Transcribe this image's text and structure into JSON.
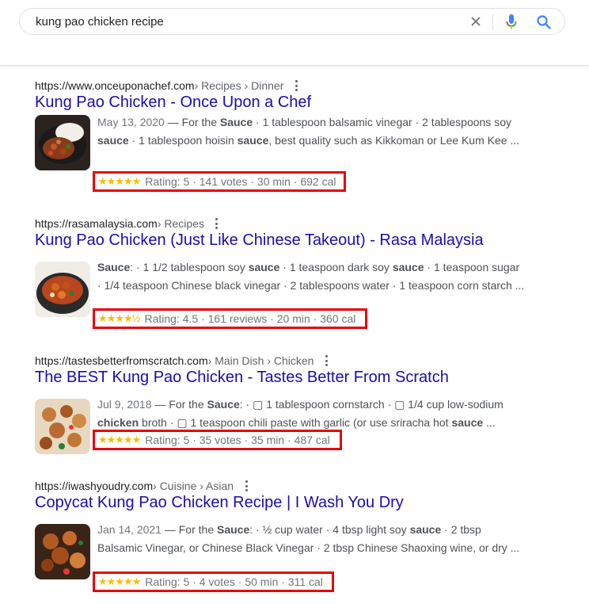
{
  "search": {
    "query": "kung pao chicken recipe"
  },
  "results": [
    {
      "domain": "https://www.onceuponachef.com",
      "path": " › Recipes › Dinner",
      "title": "Kung Pao Chicken - Once Upon a Chef",
      "date": "May 13, 2020",
      "snippet_html": " — For the <b>Sauce</b> · 1 tablespoon balsamic vinegar · 2 tablespoons soy <b>sauce</b> · 1 tablespoon hoisin <b>sauce</b>, best quality such as Kikkoman or Lee Kum Kee ...",
      "stars": "★★★★★",
      "rating_text": "Rating: 5 · 141 votes · 30 min · 692 cal",
      "rating": 5
    },
    {
      "domain": "https://rasamalaysia.com",
      "path": " › Recipes",
      "title": "Kung Pao Chicken (Just Like Chinese Takeout) - Rasa Malaysia",
      "date": "",
      "snippet_html": "<b>Sauce</b>: · 1 1/2 tablespoon soy <b>sauce</b> · 1 teaspoon dark soy <b>sauce</b> · 1 teaspoon sugar · 1/4 teaspoon Chinese black vinegar · 2 tablespoons water · 1 teaspoon corn starch ...",
      "stars": "★★★★½",
      "rating_text": "Rating: 4.5 · 161 reviews · 20 min · 360 cal",
      "rating": 4.5
    },
    {
      "domain": "https://tastesbetterfromscratch.com",
      "path": " › Main Dish › Chicken",
      "title": "The BEST Kung Pao Chicken - Tastes Better From Scratch",
      "date": "Jul 9, 2018",
      "snippet_html": " — For the <b>Sauce</b>: · ▢ 1 tablespoon cornstarch · ▢ 1/4 cup low-sodium <b>chicken</b> broth · ▢ 1 teaspoon chili paste with garlic (or use sriracha hot <b>sauce</b> ...",
      "stars": "★★★★★",
      "rating_text": "Rating: 5 · 35 votes · 35 min · 487 cal",
      "rating": 5
    },
    {
      "domain": "https://iwashyoudry.com",
      "path": " › Cuisine › Asian",
      "title": "Copycat Kung Pao Chicken Recipe | I Wash You Dry",
      "date": "Jan 14, 2021",
      "snippet_html": " — For the <b>Sauce</b>: · ½ cup water · 4 tbsp light soy <b>sauce</b> · 2 tbsp Balsamic Vinegar, or Chinese Black Vinegar · 2 tbsp Chinese Shaoxing wine, or dry ...",
      "stars": "★★★★★",
      "rating_text": "Rating: 5 · 4 votes · 50 min · 311 cal",
      "rating": 5
    }
  ],
  "colors": {
    "link": "#1a0dab",
    "highlight_box": "#e8000b",
    "star": "#fbbc04"
  }
}
